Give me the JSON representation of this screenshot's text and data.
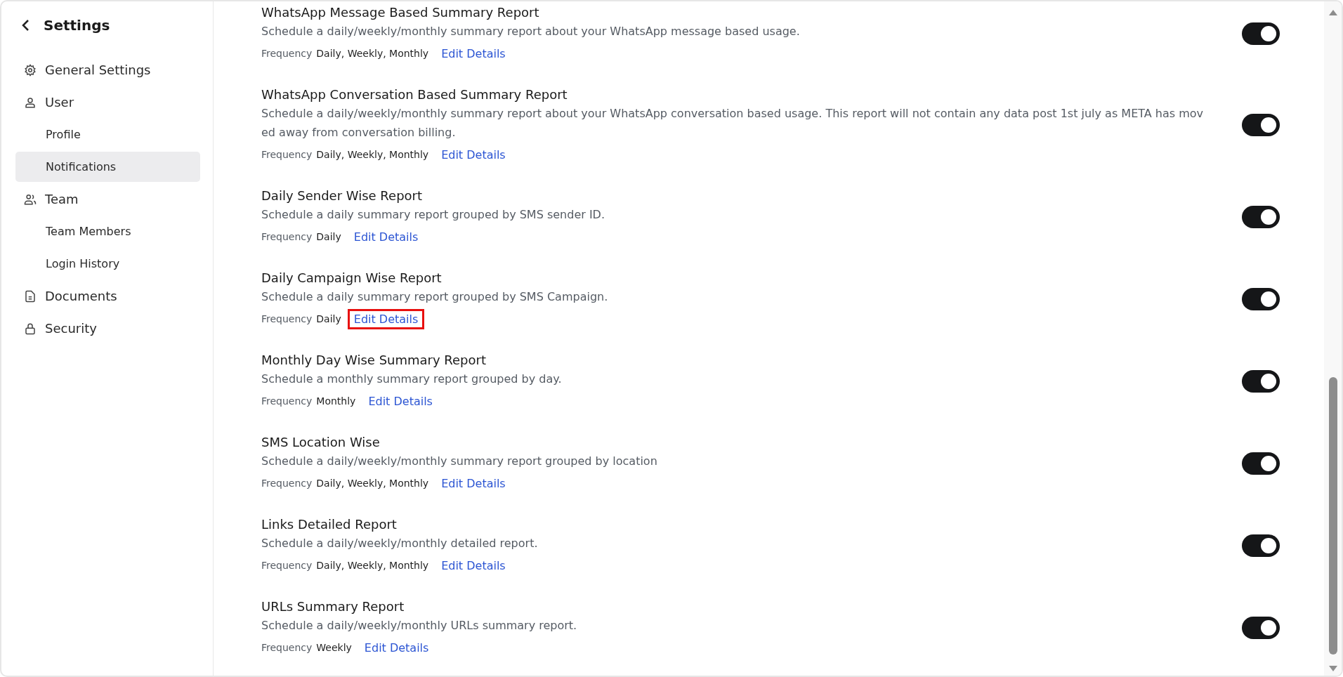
{
  "sidebar": {
    "title": "Settings",
    "items": [
      {
        "kind": "section",
        "label": "General Settings",
        "selected": false
      },
      {
        "kind": "section",
        "label": "User",
        "selected": false
      },
      {
        "kind": "sub",
        "label": "Profile",
        "selected": false
      },
      {
        "kind": "sub",
        "label": "Notifications",
        "selected": true
      },
      {
        "kind": "section",
        "label": "Team",
        "selected": false
      },
      {
        "kind": "sub",
        "label": "Team Members",
        "selected": false
      },
      {
        "kind": "sub",
        "label": "Login History",
        "selected": false
      },
      {
        "kind": "section",
        "label": "Documents",
        "selected": false
      },
      {
        "kind": "section",
        "label": "Security",
        "selected": false
      }
    ]
  },
  "reports": [
    {
      "title": "WhatsApp Message Based Summary Report",
      "description": "Schedule a daily/weekly/monthly summary report about your WhatsApp message based usage.",
      "frequency_label": "Frequency",
      "frequency": "Daily, Weekly, Monthly",
      "link": "Edit Details",
      "on": true,
      "highlighted": false
    },
    {
      "title": "WhatsApp Conversation Based Summary Report",
      "description": "Schedule a daily/weekly/monthly summary report about your WhatsApp conversation based usage. This report will not contain any data post 1st july as META has moved away from conversation billing.",
      "frequency_label": "Frequency",
      "frequency": "Daily, Weekly, Monthly",
      "link": "Edit Details",
      "on": true,
      "highlighted": false
    },
    {
      "title": "Daily Sender Wise Report",
      "description": "Schedule a daily summary report grouped by SMS sender ID.",
      "frequency_label": "Frequency",
      "frequency": "Daily",
      "link": "Edit Details",
      "on": true,
      "highlighted": false
    },
    {
      "title": "Daily Campaign Wise Report",
      "description": "Schedule a daily summary report grouped by SMS Campaign.",
      "frequency_label": "Frequency",
      "frequency": "Daily",
      "link": "Edit Details",
      "on": true,
      "highlighted": true
    },
    {
      "title": "Monthly Day Wise Summary Report",
      "description": "Schedule a monthly summary report grouped by day.",
      "frequency_label": "Frequency",
      "frequency": "Monthly",
      "link": "Edit Details",
      "on": true,
      "highlighted": false
    },
    {
      "title": "SMS Location Wise",
      "description": "Schedule a daily/weekly/monthly summary report grouped by location",
      "frequency_label": "Frequency",
      "frequency": "Daily, Weekly, Monthly",
      "link": "Edit Details",
      "on": true,
      "highlighted": false
    },
    {
      "title": "Links Detailed Report",
      "description": "Schedule a daily/weekly/monthly detailed report.",
      "frequency_label": "Frequency",
      "frequency": "Daily, Weekly, Monthly",
      "link": "Edit Details",
      "on": true,
      "highlighted": false
    },
    {
      "title": "URLs Summary Report",
      "description": "Schedule a daily/weekly/monthly URLs summary report.",
      "frequency_label": "Frequency",
      "frequency": "Weekly",
      "link": "Edit Details",
      "on": true,
      "highlighted": false
    }
  ]
}
